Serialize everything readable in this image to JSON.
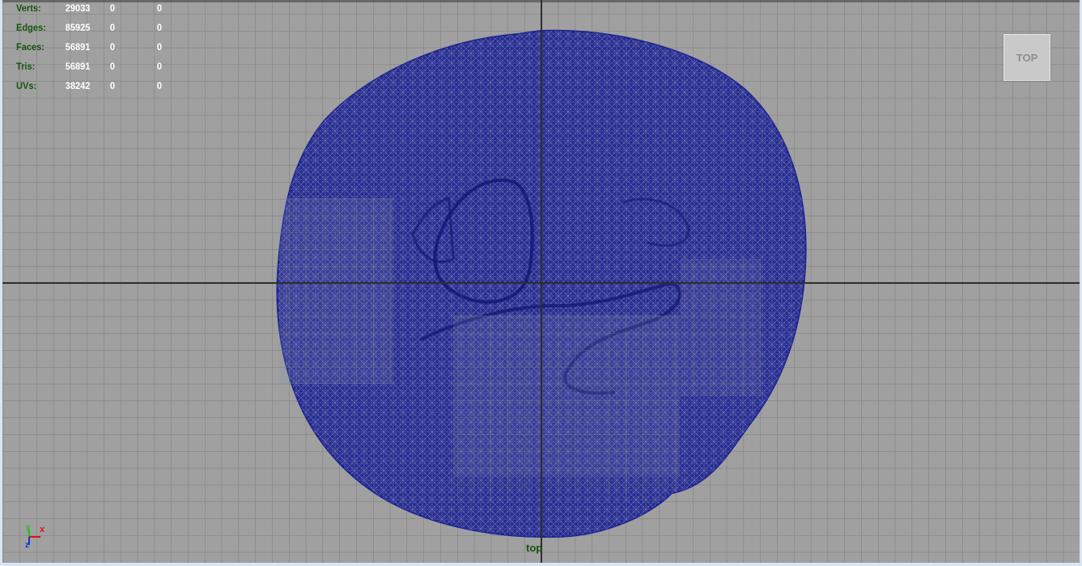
{
  "hud": {
    "rows": [
      {
        "label": "Verts:",
        "v1": "29033",
        "v2": "0",
        "v3": "0"
      },
      {
        "label": "Edges:",
        "v1": "85925",
        "v2": "0",
        "v3": "0"
      },
      {
        "label": "Faces:",
        "v1": "56891",
        "v2": "0",
        "v3": "0"
      },
      {
        "label": "Tris:",
        "v1": "56891",
        "v2": "0",
        "v3": "0"
      },
      {
        "label": "UVs:",
        "v1": "38242",
        "v2": "0",
        "v3": "0"
      }
    ]
  },
  "viewcube": {
    "label": "TOP"
  },
  "camera": {
    "label": "top"
  },
  "axis": {
    "y": "y",
    "x": "x",
    "z": "z"
  },
  "colors": {
    "background": "#a0a0a0",
    "grid_line": "#7b7b7b",
    "axis_line": "#2e2e2e",
    "wireframe": "#1a1f8c",
    "hud_label": "#15540f",
    "hud_value": "#ffffff",
    "axis_x": "#e01010",
    "axis_y": "#20c020",
    "axis_z": "#1530e0"
  }
}
